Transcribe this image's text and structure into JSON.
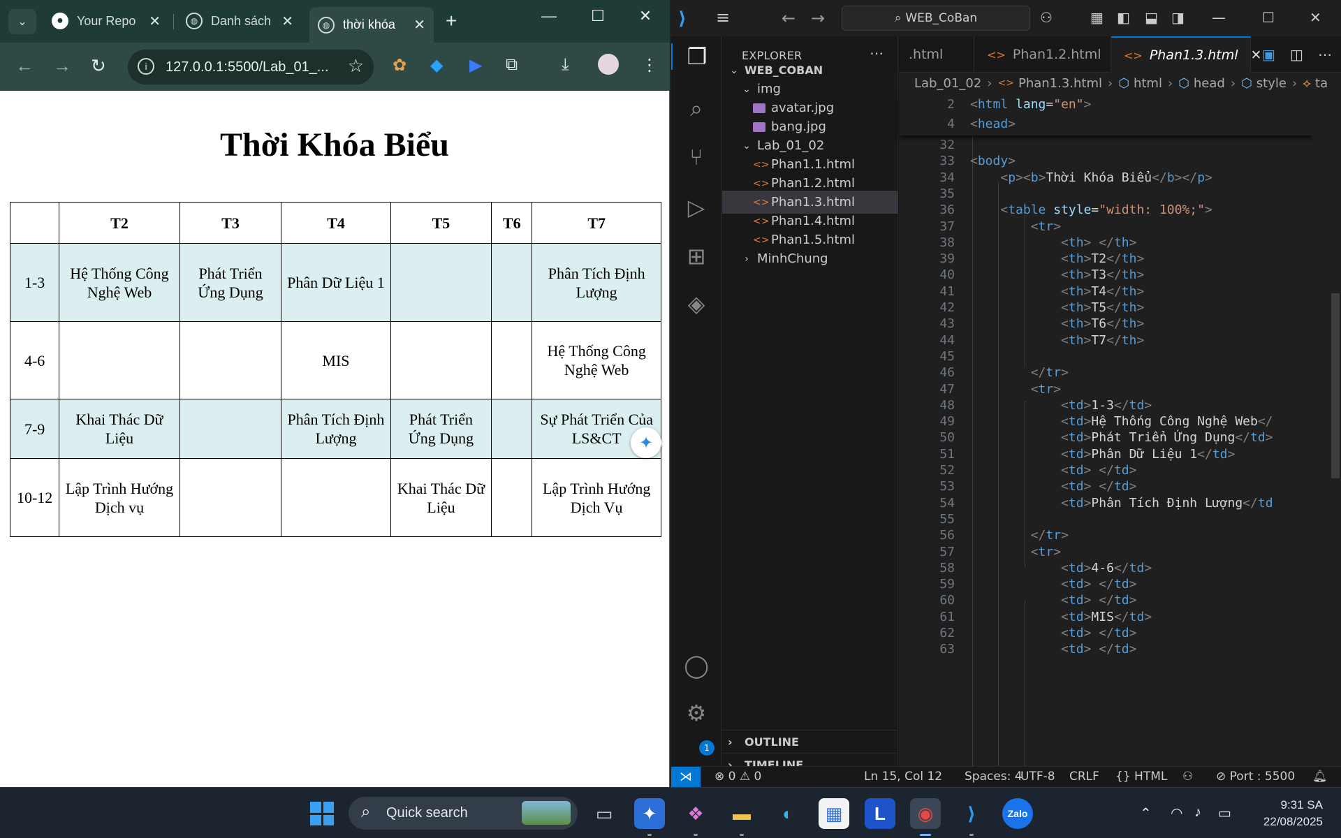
{
  "browser": {
    "tabs": [
      {
        "title": "Your Repo",
        "icon": "github-icon"
      },
      {
        "title": "Danh sách",
        "icon": "globe-icon"
      },
      {
        "title": "thời khóa",
        "icon": "globe-icon",
        "active": true
      }
    ],
    "url": "127.0.0.1:5500/Lab_01_...",
    "page": {
      "title": "Thời Khóa Biểu",
      "headers": [
        "",
        "T2",
        "T3",
        "T4",
        "T5",
        "T6",
        "T7"
      ],
      "rows": [
        [
          "1-3",
          "Hệ Thống Công Nghệ Web",
          "Phát Triển Ứng Dụng",
          "Phân Dữ Liệu 1",
          "",
          "",
          "Phân Tích Định Lượng"
        ],
        [
          "4-6",
          "",
          "",
          "MIS",
          "",
          "",
          "Hệ Thống Công Nghệ Web"
        ],
        [
          "7-9",
          "Khai Thác Dữ Liệu",
          "",
          "Phân Tích Định Lượng",
          "Phát Triển Ứng Dụng",
          "",
          "Sự Phát Triển Của LS&CT"
        ],
        [
          "10-12",
          "Lập Trình Hướng Dịch vụ",
          "",
          "",
          "Khai Thác Dữ Liệu",
          "",
          "Lập Trình Hướng Dịch Vụ"
        ]
      ],
      "row_colors": [
        "#dbeef0",
        "#ffffff",
        "#dbeef0",
        "#ffffff"
      ]
    }
  },
  "vscode": {
    "search": "WEB_CoBan",
    "explorer_title": "EXPLORER",
    "tree": [
      {
        "label": "WEB_COBAN",
        "type": "root",
        "depth": 0,
        "expanded": true
      },
      {
        "label": "img",
        "type": "folder",
        "depth": 1,
        "expanded": true
      },
      {
        "label": "avatar.jpg",
        "type": "image",
        "depth": 2
      },
      {
        "label": "bang.jpg",
        "type": "image",
        "depth": 2
      },
      {
        "label": "Lab_01_02",
        "type": "folder",
        "depth": 1,
        "expanded": true
      },
      {
        "label": "Phan1.1.html",
        "type": "html",
        "depth": 2
      },
      {
        "label": "Phan1.2.html",
        "type": "html",
        "depth": 2
      },
      {
        "label": "Phan1.3.html",
        "type": "html",
        "depth": 2,
        "selected": true
      },
      {
        "label": "Phan1.4.html",
        "type": "html",
        "depth": 2
      },
      {
        "label": "Phan1.5.html",
        "type": "html",
        "depth": 2
      },
      {
        "label": "MinhChung",
        "type": "folder",
        "depth": 1,
        "expanded": false
      }
    ],
    "outline_label": "OUTLINE",
    "timeline_label": "TIMELINE",
    "editor_tabs": [
      {
        "label": ".html",
        "active": false
      },
      {
        "label": "Phan1.2.html",
        "active": false
      },
      {
        "label": "Phan1.3.html",
        "active": true
      }
    ],
    "breadcrumbs": [
      "Lab_01_02",
      "Phan1.3.html",
      "html",
      "head",
      "style",
      "ta"
    ],
    "sticky_lines": [
      {
        "n": "2",
        "code": "<html lang=\"en\">"
      },
      {
        "n": "4",
        "code": "<head>"
      }
    ],
    "code_lines": [
      {
        "n": "32",
        "code": ""
      },
      {
        "n": "33",
        "code": "<body>"
      },
      {
        "n": "34",
        "code": "    <p><b>Thời Khóa Biểu</b></p>"
      },
      {
        "n": "35",
        "code": ""
      },
      {
        "n": "36",
        "code": "    <table style=\"width: 100%;\">"
      },
      {
        "n": "37",
        "code": "        <tr>"
      },
      {
        "n": "38",
        "code": "            <th> </th>"
      },
      {
        "n": "39",
        "code": "            <th>T2</th>"
      },
      {
        "n": "40",
        "code": "            <th>T3</th>"
      },
      {
        "n": "41",
        "code": "            <th>T4</th>"
      },
      {
        "n": "42",
        "code": "            <th>T5</th>"
      },
      {
        "n": "43",
        "code": "            <th>T6</th>"
      },
      {
        "n": "44",
        "code": "            <th>T7</th>"
      },
      {
        "n": "45",
        "code": ""
      },
      {
        "n": "46",
        "code": "        </tr>"
      },
      {
        "n": "47",
        "code": "        <tr>"
      },
      {
        "n": "48",
        "code": "            <td>1-3</td>"
      },
      {
        "n": "49",
        "code": "            <td>Hệ Thống Công Nghệ Web</"
      },
      {
        "n": "50",
        "code": "            <td>Phát Triển Ứng Dụng</td>"
      },
      {
        "n": "51",
        "code": "            <td>Phân Dữ Liệu 1</td>"
      },
      {
        "n": "52",
        "code": "            <td> </td>"
      },
      {
        "n": "53",
        "code": "            <td> </td>"
      },
      {
        "n": "54",
        "code": "            <td>Phân Tích Định Lượng</td"
      },
      {
        "n": "55",
        "code": ""
      },
      {
        "n": "56",
        "code": "        </tr>"
      },
      {
        "n": "57",
        "code": "        <tr>"
      },
      {
        "n": "58",
        "code": "            <td>4-6</td>"
      },
      {
        "n": "59",
        "code": "            <td> </td>"
      },
      {
        "n": "60",
        "code": "            <td> </td>"
      },
      {
        "n": "61",
        "code": "            <td>MIS</td>"
      },
      {
        "n": "62",
        "code": "            <td> </td>"
      },
      {
        "n": "63",
        "code": "            <td> </td>"
      }
    ],
    "status": {
      "errors": "0",
      "warnings": "0",
      "position": "Ln 15, Col 12",
      "spaces": "Spaces: 4",
      "encoding": "UTF-8",
      "eol": "CRLF",
      "language": "HTML",
      "port": "Port : 5500"
    }
  },
  "taskbar": {
    "search_placeholder": "Quick search",
    "time": "9:31 SA",
    "date": "22/08/2025",
    "apps": [
      "task-view",
      "copilot-pre",
      "copilot",
      "file-explorer",
      "edge",
      "microsoft-store",
      "L-app",
      "chrome",
      "vscode",
      "zalo"
    ]
  }
}
